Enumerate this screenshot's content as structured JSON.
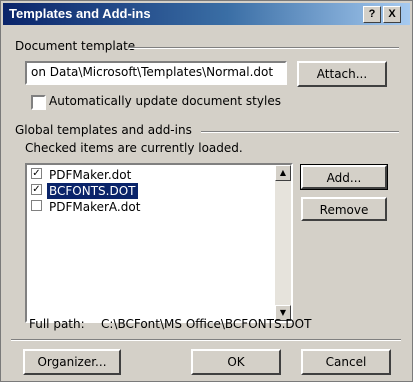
{
  "window": {
    "title": "Templates and Add-ins",
    "help_label": "?",
    "close_label": "X"
  },
  "document_template": {
    "group_label": "Document template",
    "path_value": "on Data\\Microsoft\\Templates\\Normal.dot",
    "attach_label": "Attach...",
    "auto_update_label": "Automatically update document styles",
    "auto_update_checked": false
  },
  "global_templates": {
    "group_label": "Global templates and add-ins",
    "hint": "Checked items are currently loaded.",
    "items": [
      {
        "label": "PDFMaker.dot",
        "checked": true,
        "selected": false
      },
      {
        "label": "BCFONTS.DOT",
        "checked": true,
        "selected": true
      },
      {
        "label": "PDFMakerA.dot",
        "checked": false,
        "selected": false
      }
    ],
    "add_label": "Add...",
    "remove_label": "Remove",
    "full_path_label": "Full path:",
    "full_path_value": "C:\\BCFont\\MS Office\\BCFONTS.DOT"
  },
  "footer": {
    "organizer_label": "Organizer...",
    "ok_label": "OK",
    "cancel_label": "Cancel"
  },
  "icons": {
    "check": "✓",
    "scroll_up": "▲",
    "scroll_down": "▼"
  }
}
